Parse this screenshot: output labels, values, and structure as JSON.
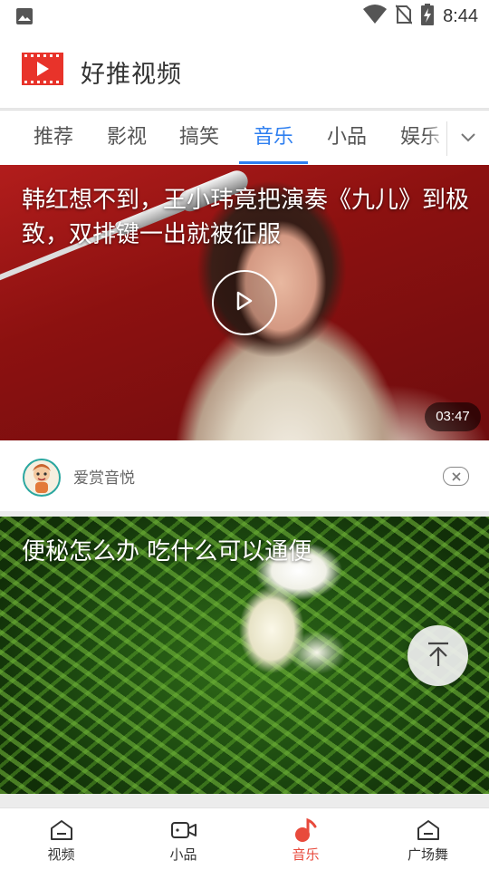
{
  "status_bar": {
    "time": "8:44"
  },
  "app": {
    "title": "好推视频"
  },
  "tabs": [
    {
      "label": "推荐"
    },
    {
      "label": "影视"
    },
    {
      "label": "搞笑"
    },
    {
      "label": "音乐"
    },
    {
      "label": "小品"
    },
    {
      "label": "娱乐"
    }
  ],
  "active_tab": "音乐",
  "feed": [
    {
      "title": "韩红想不到，王小玮竟把演奏《九儿》到极致，双排键一出就被征服",
      "duration": "03:47",
      "source": "爱赏音悦"
    },
    {
      "title": "便秘怎么办 吃什么可以通便"
    }
  ],
  "bottom_nav": [
    {
      "label": "视频",
      "icon": "home-icon"
    },
    {
      "label": "小品",
      "icon": "video-camera-icon"
    },
    {
      "label": "音乐",
      "icon": "music-note-icon"
    },
    {
      "label": "广场舞",
      "icon": "home-icon"
    }
  ],
  "colors": {
    "accent_blue": "#2e7ff0",
    "accent_red": "#e84a3c",
    "logo_red": "#e8332a"
  }
}
